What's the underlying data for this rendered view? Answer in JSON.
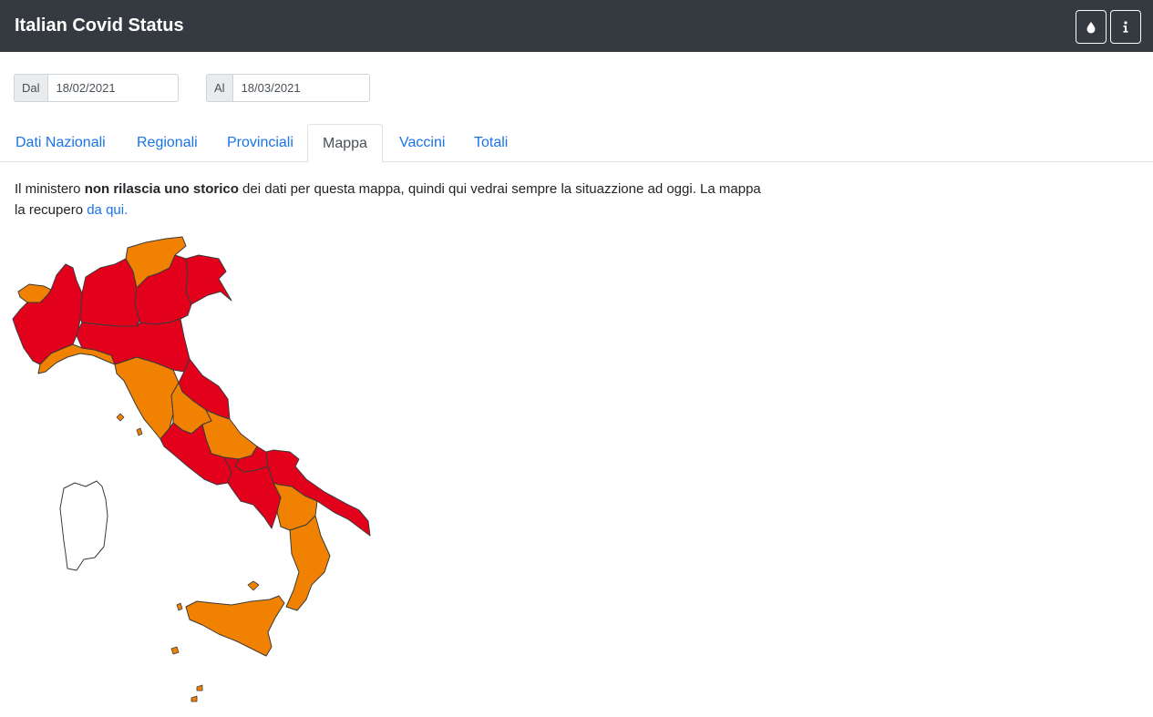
{
  "header": {
    "title": "Italian Covid Status"
  },
  "toolbar": {
    "theme_icon": "droplet-icon",
    "info_icon": "info-icon"
  },
  "date_range": {
    "from": {
      "label": "Dal",
      "value": "18/02/2021"
    },
    "to": {
      "label": "Al",
      "value": "18/03/2021"
    }
  },
  "tabs": [
    {
      "label": "Dati Nazionali",
      "active": false
    },
    {
      "label": "Regionali",
      "active": false
    },
    {
      "label": "Provinciali",
      "active": false
    },
    {
      "label": "Mappa",
      "active": true
    },
    {
      "label": "Vaccini",
      "active": false
    },
    {
      "label": "Totali",
      "active": false
    }
  ],
  "intro": {
    "part1": "Il ministero ",
    "bold": "non rilascia uno storico",
    "part2": " dei dati per questa mappa, quindi qui vedrai sempre la situazzione ad oggi. La mappa la recupero ",
    "link": "da qui."
  },
  "map": {
    "colors": {
      "red": "#e3001b",
      "orange": "#f18201",
      "white": "#ffffff",
      "border": "#3a3a3a"
    },
    "regions": [
      {
        "name": "Valle d'Aosta",
        "zone": "orange"
      },
      {
        "name": "Piemonte",
        "zone": "red"
      },
      {
        "name": "Lombardia",
        "zone": "red"
      },
      {
        "name": "Trentino-Alto Adige",
        "zone": "orange"
      },
      {
        "name": "Veneto",
        "zone": "red"
      },
      {
        "name": "Friuli-Venezia Giulia",
        "zone": "red"
      },
      {
        "name": "Liguria",
        "zone": "orange"
      },
      {
        "name": "Emilia-Romagna",
        "zone": "red"
      },
      {
        "name": "Toscana",
        "zone": "orange"
      },
      {
        "name": "Marche",
        "zone": "red"
      },
      {
        "name": "Umbria",
        "zone": "orange"
      },
      {
        "name": "Lazio",
        "zone": "red"
      },
      {
        "name": "Abruzzo",
        "zone": "orange"
      },
      {
        "name": "Molise",
        "zone": "red"
      },
      {
        "name": "Campania",
        "zone": "red"
      },
      {
        "name": "Puglia",
        "zone": "red"
      },
      {
        "name": "Basilicata",
        "zone": "orange"
      },
      {
        "name": "Calabria",
        "zone": "orange"
      },
      {
        "name": "Sicilia",
        "zone": "orange"
      },
      {
        "name": "Sardegna",
        "zone": "white"
      }
    ]
  }
}
